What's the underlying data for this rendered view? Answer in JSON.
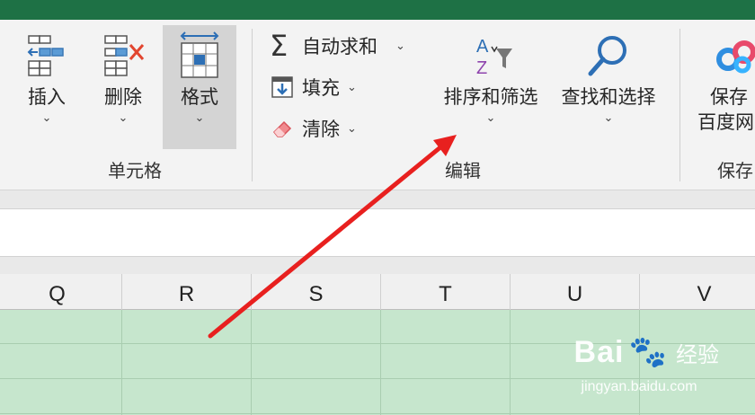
{
  "ribbon": {
    "cells_group": {
      "label": "单元格",
      "insert": "插入",
      "delete": "删除",
      "format": "格式"
    },
    "editing_group": {
      "label": "编辑",
      "autosum": "自动求和",
      "fill": "填充",
      "clear": "清除",
      "sort_filter": "排序和筛选",
      "find_select": "查找和选择"
    },
    "save_group": {
      "label": "保存",
      "button_line1": "保存",
      "button_line2": "百度网"
    },
    "chevron": "⌄"
  },
  "sheet": {
    "columns": [
      "Q",
      "R",
      "S",
      "T",
      "U",
      "V"
    ],
    "fill_color": "#c6e6cd"
  },
  "annotation": {
    "arrow_color": "#e8201f"
  },
  "watermark": {
    "brand": "Bai",
    "brand2": "经验",
    "url": "jingyan.baidu.com"
  }
}
